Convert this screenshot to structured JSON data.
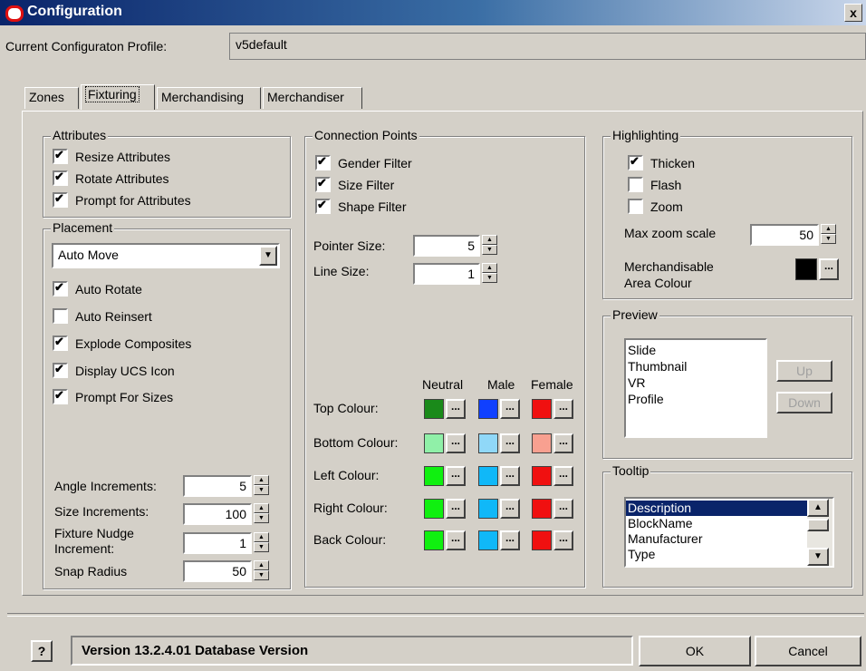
{
  "title": "Configuration",
  "close_glyph": "x",
  "profile": {
    "label": "Current Configuraton Profile:",
    "value": "v5default"
  },
  "tabs": [
    {
      "label": "Zones"
    },
    {
      "label": "Fixturing"
    },
    {
      "label": "Merchandising"
    },
    {
      "label": "Merchandiser"
    }
  ],
  "attributes": {
    "title": "Attributes",
    "items": [
      {
        "label": "Resize Attributes",
        "checked": true
      },
      {
        "label": "Rotate Attributes",
        "checked": true
      },
      {
        "label": "Prompt for Attributes",
        "checked": true
      }
    ]
  },
  "placement": {
    "title": "Placement",
    "dropdown_value": "Auto Move",
    "items": [
      {
        "label": "Auto Rotate",
        "checked": true
      },
      {
        "label": "Auto Reinsert",
        "checked": false
      },
      {
        "label": "Explode Composites",
        "checked": true
      },
      {
        "label": "Display UCS Icon",
        "checked": true
      },
      {
        "label": "Prompt For Sizes",
        "checked": true
      }
    ],
    "angle_label": "Angle Increments:",
    "angle_value": "5",
    "size_label": "Size Increments:",
    "size_value": "100",
    "nudge_label": "Fixture Nudge Increment:",
    "nudge_value": "1",
    "snap_label": "Snap Radius",
    "snap_value": "50"
  },
  "connection": {
    "title": "Connection Points",
    "items": [
      {
        "label": "Gender Filter",
        "checked": true
      },
      {
        "label": "Size Filter",
        "checked": true
      },
      {
        "label": "Shape Filter",
        "checked": true
      }
    ],
    "pointer_label": "Pointer Size:",
    "pointer_value": "5",
    "line_label": "Line Size:",
    "line_value": "1",
    "col_neutral": "Neutral",
    "col_male": "Male",
    "col_female": "Female",
    "rows": [
      {
        "label": "Top Colour:",
        "colors": [
          "#1a8a1a",
          "#1040ff",
          "#f01010"
        ]
      },
      {
        "label": "Bottom Colour:",
        "colors": [
          "#90f0a8",
          "#90d8f8",
          "#f8a090"
        ]
      },
      {
        "label": "Left Colour:",
        "colors": [
          "#10f010",
          "#10b8f8",
          "#f01010"
        ]
      },
      {
        "label": "Right Colour:",
        "colors": [
          "#10f010",
          "#10b8f8",
          "#f01010"
        ]
      },
      {
        "label": "Back Colour:",
        "colors": [
          "#10f010",
          "#10b8f8",
          "#f01010"
        ]
      }
    ],
    "dots": "..."
  },
  "highlighting": {
    "title": "Highlighting",
    "items": [
      {
        "label": "Thicken",
        "checked": true
      },
      {
        "label": "Flash",
        "checked": false
      },
      {
        "label": "Zoom",
        "checked": false
      }
    ],
    "zoom_label": "Max zoom scale",
    "zoom_value": "50",
    "area_label_1": "Merchandisable",
    "area_label_2": "Area Colour",
    "area_color": "#000000"
  },
  "preview": {
    "title": "Preview",
    "items": [
      "Slide",
      "Thumbnail",
      "VR",
      "Profile"
    ],
    "up": "Up",
    "down": "Down"
  },
  "tooltip": {
    "title": "Tooltip",
    "items": [
      "Description",
      "BlockName",
      "Manufacturer",
      "Type"
    ]
  },
  "status": {
    "help_glyph": "?",
    "text": "Version 13.2.4.01 Database Version",
    "ok": "OK",
    "cancel": "Cancel"
  }
}
